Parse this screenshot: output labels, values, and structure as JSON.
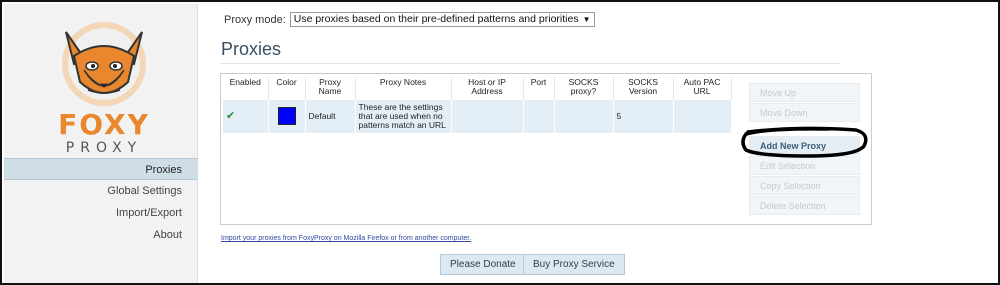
{
  "logo": {
    "word1": "FOXY",
    "word2": "PROXY"
  },
  "sidebar": {
    "items": [
      {
        "label": "Proxies",
        "active": true
      },
      {
        "label": "Global Settings",
        "active": false
      },
      {
        "label": "Import/Export",
        "active": false
      },
      {
        "label": "About",
        "active": false
      }
    ]
  },
  "proxy_mode": {
    "label": "Proxy mode:",
    "selected": "Use proxies based on their pre-defined patterns and priorities"
  },
  "page_title": "Proxies",
  "table": {
    "headers": [
      "Enabled",
      "Color",
      "Proxy Name",
      "Proxy Notes",
      "Host or IP Address",
      "Port",
      "SOCKS proxy?",
      "SOCKS Version",
      "Auto PAC URL"
    ],
    "rows": [
      {
        "enabled": true,
        "color": "#0000ff",
        "name": "Default",
        "notes": "These are the settings that are used when no patterns match an URL",
        "host": "",
        "port": "",
        "socks": "",
        "socks_version": "5",
        "pac_url": ""
      }
    ]
  },
  "side_buttons": [
    {
      "label": "Move Up",
      "enabled": false
    },
    {
      "label": "Move Down",
      "enabled": false
    },
    {
      "label": "Add New Proxy",
      "enabled": true
    },
    {
      "label": "Edit Selection",
      "enabled": false
    },
    {
      "label": "Copy Selection",
      "enabled": false
    },
    {
      "label": "Delete Selection",
      "enabled": false
    }
  ],
  "import_link": "Import your proxies from FoxyProxy on Mozilla Firefox or from another computer.",
  "bottom_buttons": {
    "donate": "Please Donate",
    "buy": "Buy Proxy Service"
  },
  "colors": {
    "accent": "#3a4f63",
    "logo_orange": "#e8872d",
    "row_bg": "#e3eef7",
    "annotation": "#000000"
  }
}
